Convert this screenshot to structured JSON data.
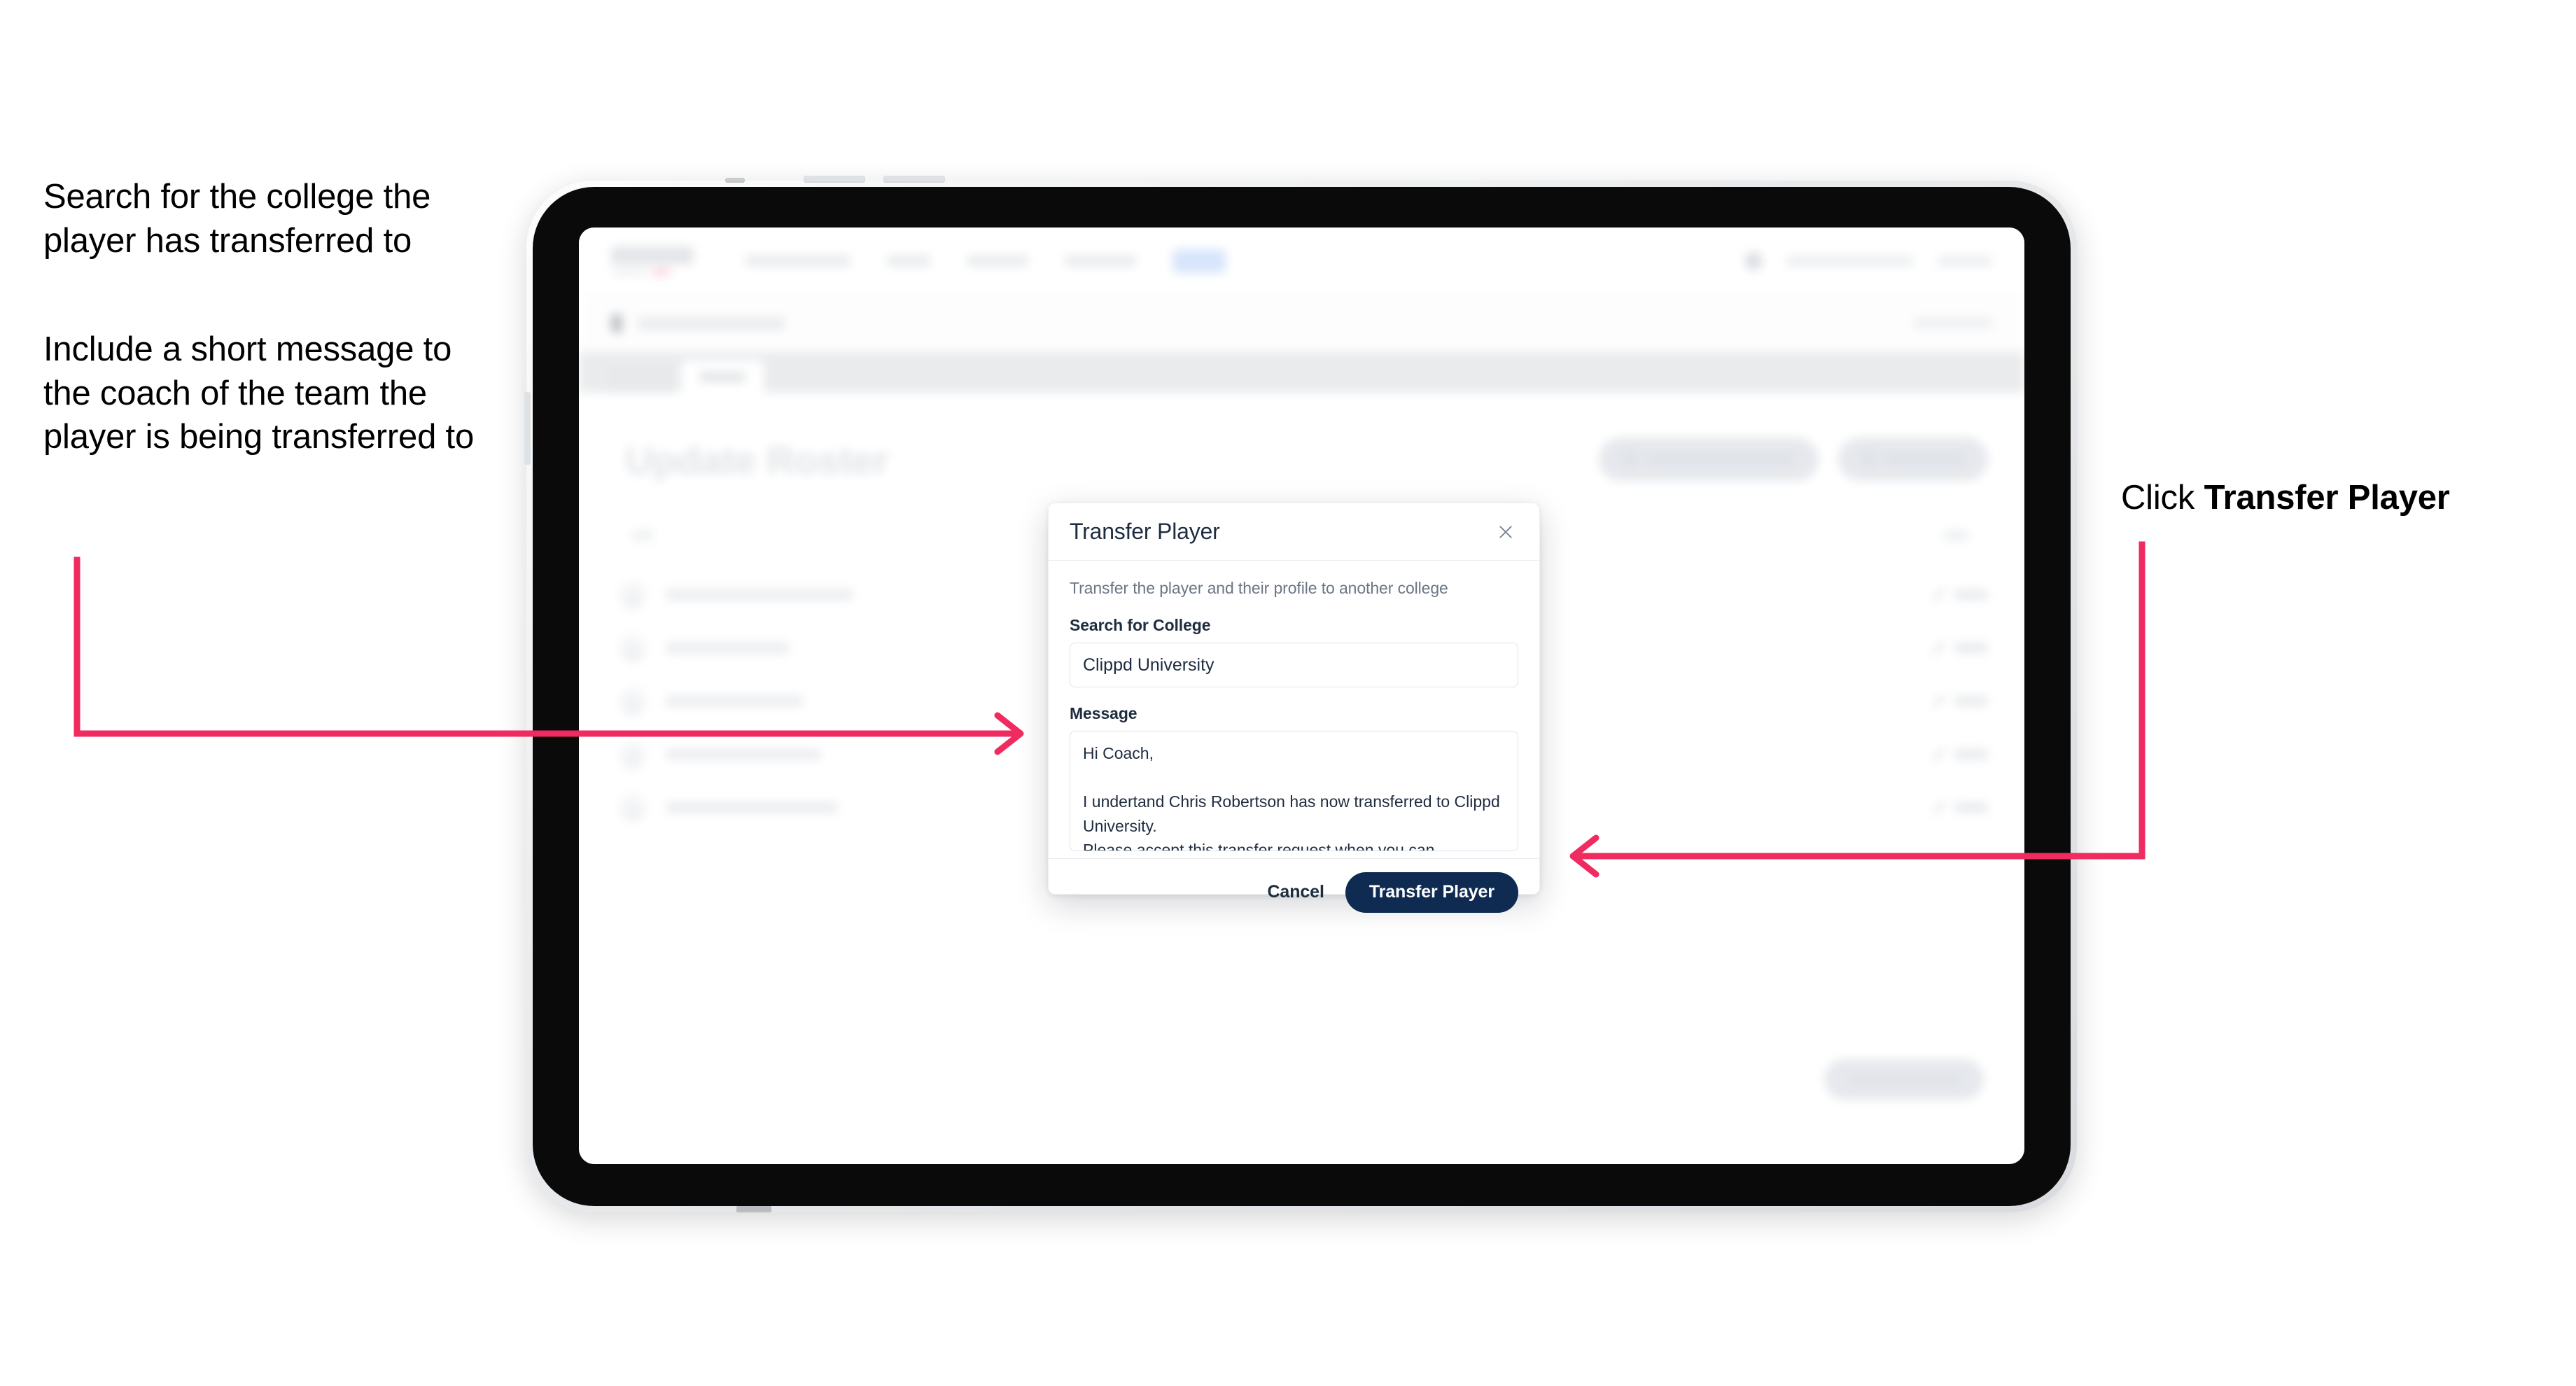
{
  "annotations": {
    "left_1": "Search for the college the player has transferred to",
    "left_2": "Include a short message to the coach of the team the player is being transferred to",
    "right_prefix": "Click ",
    "right_emphasis": "Transfer Player"
  },
  "colors": {
    "arrow_pink": "#ef2b60",
    "primary_navy": "#0f2b52",
    "text_dark": "#1e2c3f",
    "muted": "#6b7685"
  },
  "app": {
    "page_title": "Update Roster",
    "tabs": [
      "",
      ""
    ],
    "actions": [
      "",
      ""
    ],
    "rows": [
      {
        "name": "",
        "action": ""
      },
      {
        "name": "",
        "action": ""
      },
      {
        "name": "",
        "action": ""
      },
      {
        "name": "",
        "action": ""
      },
      {
        "name": "",
        "action": ""
      }
    ]
  },
  "modal": {
    "title": "Transfer Player",
    "close_icon": "close-icon",
    "description": "Transfer the player and their profile to another college",
    "college_label": "Search for College",
    "college_value": "Clippd University",
    "message_label": "Message",
    "message_value": "Hi Coach,\n\nI undertand Chris Robertson has now transferred to Clippd University.\nPlease accept this transfer request when you can.",
    "cancel_label": "Cancel",
    "submit_label": "Transfer Player"
  }
}
